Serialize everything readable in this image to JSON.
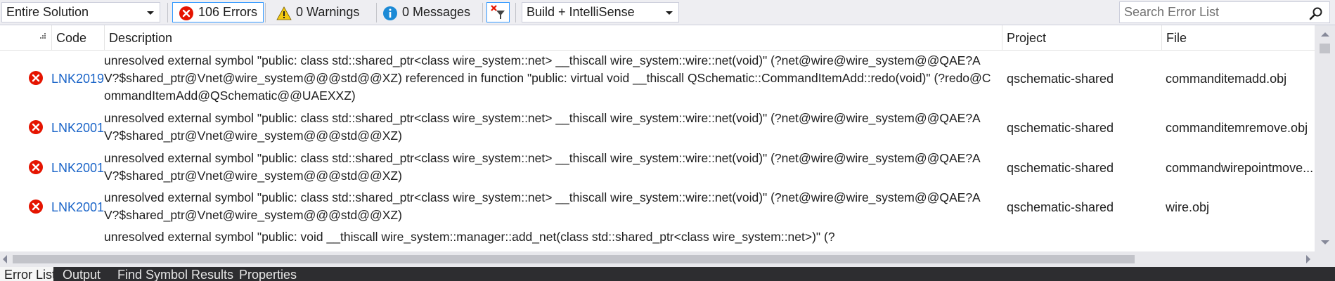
{
  "toolbar": {
    "scope_select": "Entire Solution",
    "errors_label": "106 Errors",
    "warnings_label": "0 Warnings",
    "messages_label": "0 Messages",
    "build_select": "Build + IntelliSense",
    "search_placeholder": "Search Error List",
    "icons": {
      "errors": "error-icon",
      "warnings": "warning-icon",
      "messages": "info-icon",
      "filter": "filter-toggle-icon",
      "search": "search-icon"
    }
  },
  "columns": {
    "code": "Code",
    "description": "Description",
    "project": "Project",
    "file": "File"
  },
  "rows": [
    {
      "code": "LNK2019",
      "description": "unresolved external symbol \"public: class std::shared_ptr<class wire_system::net> __thiscall wire_system::wire::net(void)\" (?net@wire@wire_system@@QAE?AV?$shared_ptr@Vnet@wire_system@@@std@@XZ) referenced in function \"public: virtual void __thiscall QSchematic::CommandItemAdd::redo(void)\" (?redo@CommandItemAdd@QSchematic@@UAEXXZ)",
      "project": "qschematic-shared",
      "file": "commanditemadd.obj"
    },
    {
      "code": "LNK2001",
      "description": "unresolved external symbol \"public: class std::shared_ptr<class wire_system::net> __thiscall wire_system::wire::net(void)\" (?net@wire@wire_system@@QAE?AV?$shared_ptr@Vnet@wire_system@@@std@@XZ)",
      "project": "qschematic-shared",
      "file": "commanditemremove.obj"
    },
    {
      "code": "LNK2001",
      "description": "unresolved external symbol \"public: class std::shared_ptr<class wire_system::net> __thiscall wire_system::wire::net(void)\" (?net@wire@wire_system@@QAE?AV?$shared_ptr@Vnet@wire_system@@@std@@XZ)",
      "project": "qschematic-shared",
      "file": "commandwirepointmove..."
    },
    {
      "code": "LNK2001",
      "description": "unresolved external symbol \"public: class std::shared_ptr<class wire_system::net> __thiscall wire_system::wire::net(void)\" (?net@wire@wire_system@@QAE?AV?$shared_ptr@Vnet@wire_system@@@std@@XZ)",
      "project": "qschematic-shared",
      "file": "wire.obj"
    },
    {
      "code": "",
      "description": "unresolved external symbol \"public: void __thiscall wire_system::manager::add_net(class std::shared_ptr<class wire_system::net>)\" (?",
      "project": "",
      "file": ""
    }
  ],
  "bottom_tabs": [
    {
      "label": "Error List",
      "active": true
    },
    {
      "label": "Output",
      "active": false
    },
    {
      "label": "Find Symbol Results",
      "active": false
    },
    {
      "label": "Properties",
      "active": false
    }
  ],
  "colors": {
    "error_red": "#e51400",
    "warning_yellow": "#f2c811",
    "info_blue": "#1c8ad6",
    "link_blue": "#1a64c8",
    "toolbar_bg": "#eeeef2",
    "tabbar_bg": "#2d2d30"
  }
}
